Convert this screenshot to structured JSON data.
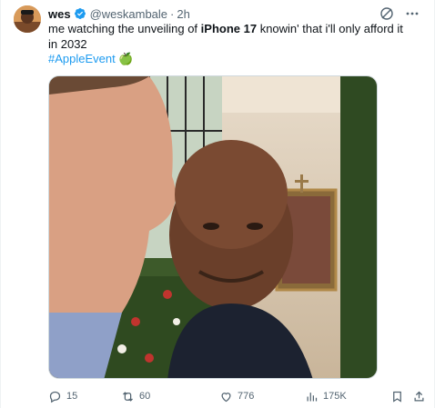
{
  "tweet": {
    "display_name": "wes",
    "handle": "@weskambale",
    "separator": "·",
    "time": "2h",
    "text_before": "me watching the unveiling of ",
    "text_bold": "iPhone 17",
    "text_after": " knowin' that i'll only afford it in 2032",
    "hashtag": "#AppleEvent",
    "hashtag_emoji": "🍏",
    "media_description": "",
    "actions": {
      "replies": "15",
      "retweets": "60",
      "likes": "776",
      "views": "175K"
    }
  },
  "colors": {
    "link": "#1d9bf0",
    "verified": "#1d9bf0",
    "muted": "#536471",
    "text": "#0f1419"
  },
  "icons": {
    "verified": "verified-badge-icon",
    "grok": "grok-icon",
    "more": "more-dots-icon",
    "reply": "reply-icon",
    "retweet": "retweet-icon",
    "like": "heart-icon",
    "views": "views-chart-icon",
    "bookmark": "bookmark-icon",
    "share": "share-icon"
  }
}
